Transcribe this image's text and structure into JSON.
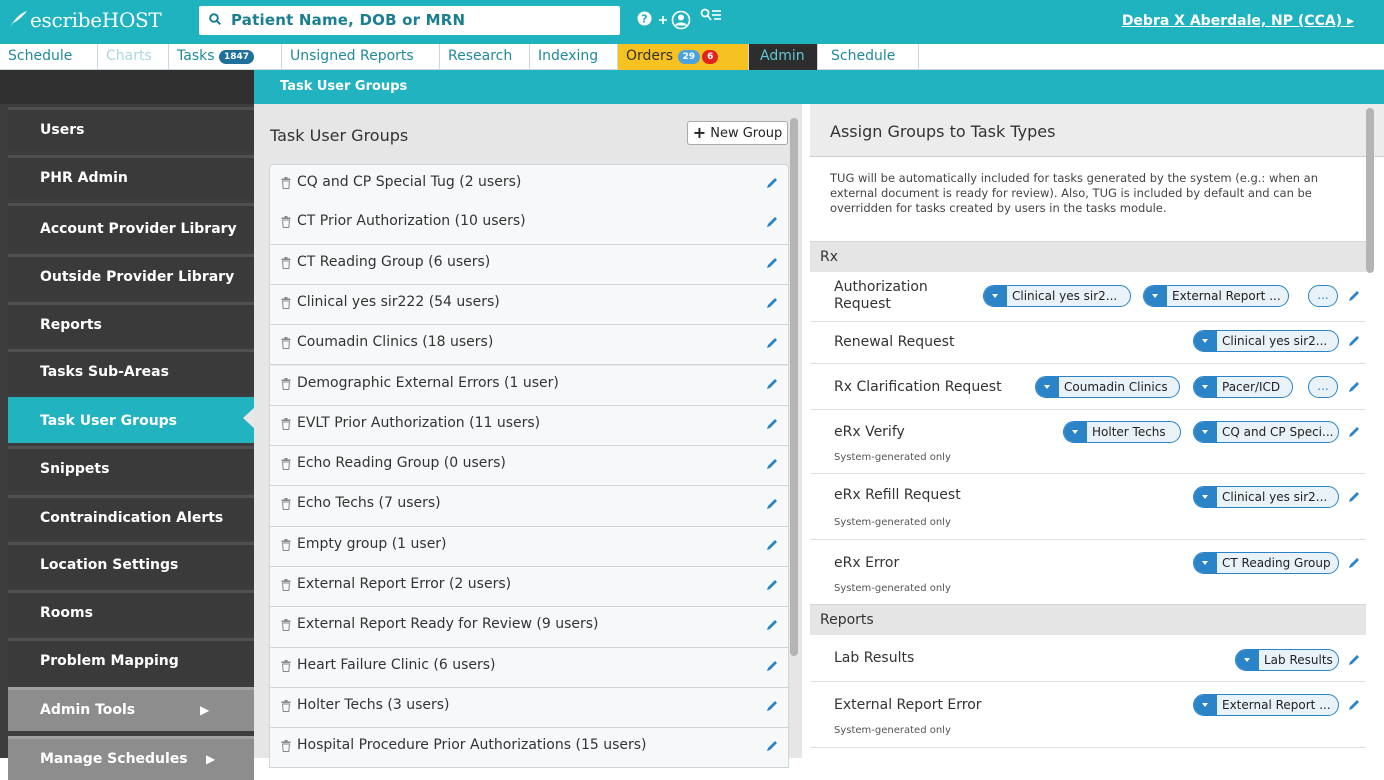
{
  "header": {
    "logo_text": "escribeHOST",
    "search_placeholder": "Patient Name, DOB or MRN",
    "user_name": "Debra X Aberdale, NP (CCA) ▸"
  },
  "tabs": [
    {
      "label": "Schedule"
    },
    {
      "label": "Charts"
    },
    {
      "label": "Tasks",
      "badge": "1847"
    },
    {
      "label": "Unsigned Reports"
    },
    {
      "label": "Research"
    },
    {
      "label": "Indexing"
    },
    {
      "label": "Orders",
      "badge": "29",
      "badge2": "6"
    },
    {
      "label": "Admin"
    },
    {
      "label": "Schedule"
    }
  ],
  "subbar": {
    "title": "Task User Groups"
  },
  "sidebar": {
    "items": [
      {
        "label": "Users"
      },
      {
        "label": "PHR Admin"
      },
      {
        "label": "Account Provider Library"
      },
      {
        "label": "Outside Provider Library"
      },
      {
        "label": "Reports"
      },
      {
        "label": "Tasks Sub-Areas"
      },
      {
        "label": "Task User Groups"
      },
      {
        "label": "Snippets"
      },
      {
        "label": "Contraindication Alerts"
      },
      {
        "label": "Location Settings"
      },
      {
        "label": "Rooms"
      },
      {
        "label": "Problem Mapping"
      },
      {
        "label": "Admin Tools"
      },
      {
        "label": "Manage Schedules"
      }
    ]
  },
  "groups_panel": {
    "title": "Task User Groups",
    "new_button": "New Group",
    "groups": [
      "CQ and CP Special Tug  (2 users)",
      "CT Prior Authorization  (10 users)",
      "CT Reading Group  (6 users)",
      "Clinical yes sir222  (54 users)",
      "Coumadin Clinics  (18 users)",
      "Demographic External Errors  (1 user)",
      "EVLT Prior Authorization  (11 users)",
      "Echo Reading Group  (0 users)",
      "Echo Techs  (7 users)",
      "Empty group  (1 user)",
      "External Report Error  (2 users)",
      "External Report Ready for Review  (9 users)",
      "Heart Failure Clinic  (6 users)",
      "Holter Techs  (3 users)",
      "Hospital Procedure Prior Authorizations  (15 users)"
    ]
  },
  "assign_panel": {
    "title": "Assign Groups to Task Types",
    "description": "TUG will be automatically included for tasks generated by the system (e.g.: when an external document is ready for review). Also, TUG is included by default and can be overridden for tasks created by users in the tasks module.",
    "sections": [
      {
        "name": "Rx"
      },
      {
        "name": "Reports"
      }
    ],
    "system_note": "System-generated only",
    "more_label": "...",
    "rows": [
      {
        "name": "Authorization Request",
        "pills": [
          "Clinical yes sir2...",
          "External Report ..."
        ]
      },
      {
        "name": "Renewal Request",
        "pills": [
          "Clinical yes sir2..."
        ]
      },
      {
        "name": "Rx Clarification Request",
        "pills": [
          "Coumadin Clinics",
          "Pacer/ICD"
        ]
      },
      {
        "name": "eRx Verify",
        "pills": [
          "Holter Techs",
          "CQ and CP Speci..."
        ]
      },
      {
        "name": "eRx Refill Request",
        "pills": [
          "Clinical yes sir2..."
        ]
      },
      {
        "name": "eRx Error",
        "pills": [
          "CT Reading Group"
        ]
      },
      {
        "name": "Lab Results",
        "pills": [
          "Lab Results"
        ]
      },
      {
        "name": "External Report Error",
        "pills": [
          "External Report ..."
        ]
      }
    ]
  }
}
